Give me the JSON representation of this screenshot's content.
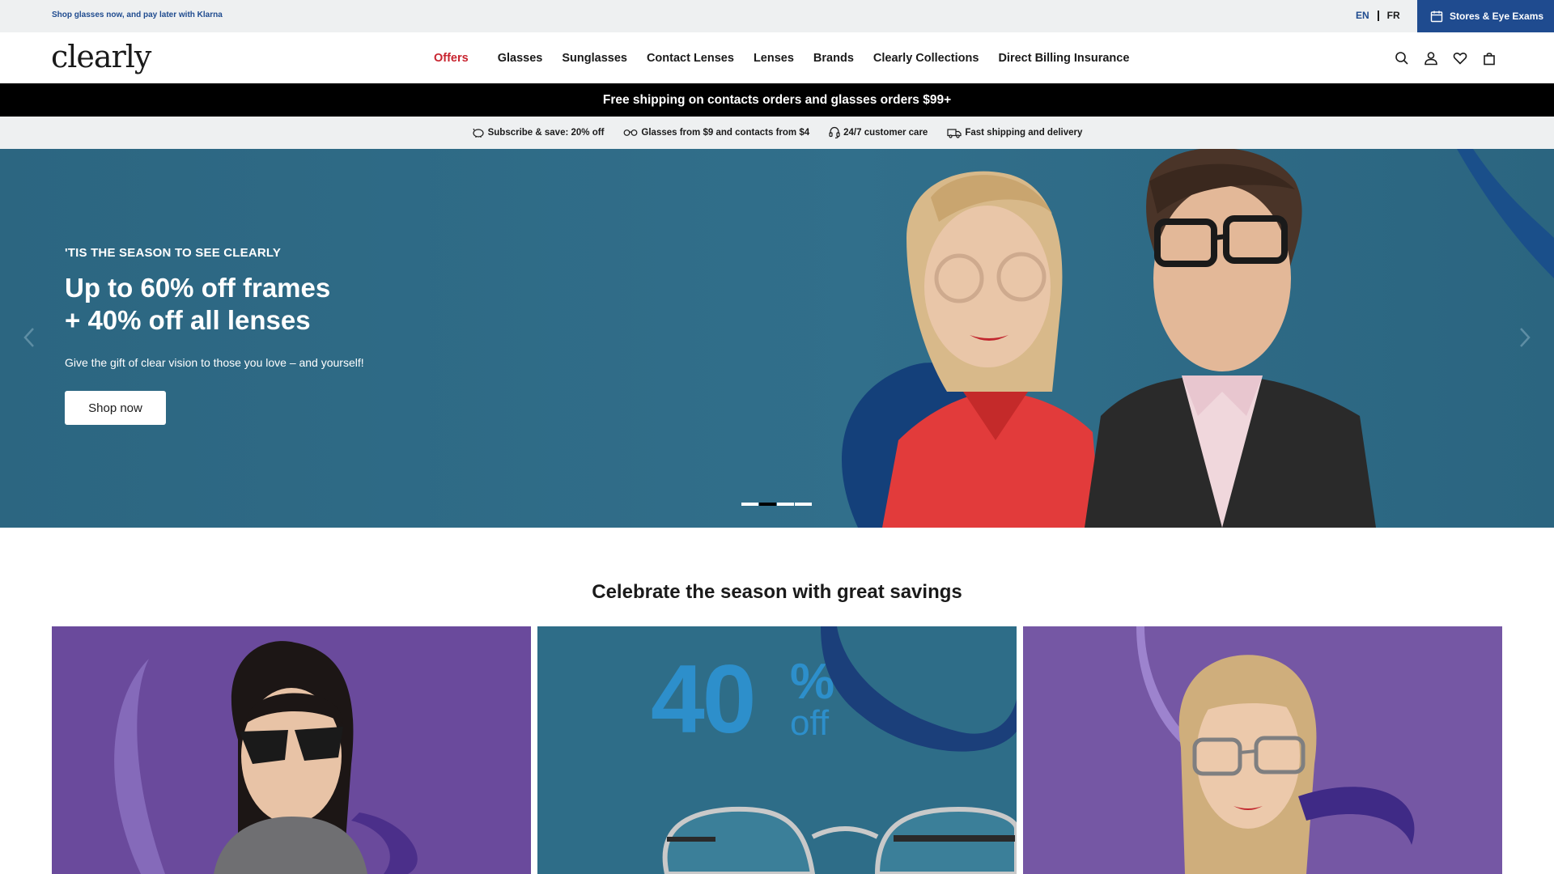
{
  "utility_bar": {
    "klarna_text": "Shop glasses now, and pay later with Klarna",
    "lang_en": "EN",
    "lang_fr": "FR",
    "stores_label": "Stores & Eye Exams"
  },
  "header": {
    "logo": "clearly",
    "nav": [
      "Offers",
      "Glasses",
      "Sunglasses",
      "Contact Lenses",
      "Lenses",
      "Brands",
      "Clearly Collections",
      "Direct Billing Insurance"
    ],
    "icons": [
      "search-icon",
      "account-icon",
      "heart-icon",
      "bag-icon"
    ]
  },
  "shipping_bar": {
    "text": "Free shipping on contacts orders and glasses orders $99+"
  },
  "benefits": [
    {
      "icon": "piggy-bank-icon",
      "text": "Subscribe & save: 20% off"
    },
    {
      "icon": "glasses-icon",
      "text": "Glasses from $9 and contacts from $4"
    },
    {
      "icon": "headset-icon",
      "text": "24/7 customer care"
    },
    {
      "icon": "truck-icon",
      "text": "Fast shipping and delivery"
    }
  ],
  "hero": {
    "eyebrow": "'TIS THE SEASON TO SEE CLEARLY",
    "title_line1": "Up to 60% off frames",
    "title_line2": "+ 40% off all lenses",
    "subtitle": "Give the gift of clear vision to those you love – and yourself!",
    "cta": "Shop now",
    "active_slide": 2,
    "total_slides": 4
  },
  "savings": {
    "heading": "Celebrate the season with great savings",
    "card2_number": "40",
    "card2_percent": "%",
    "card2_off": "off"
  },
  "colors": {
    "brand_blue": "#1f4b8f",
    "offers_red": "#c8242f",
    "hero_bg": "#2e6b86",
    "promo_purple": "#6a4a9c",
    "promo_teal": "#2e6d88"
  }
}
